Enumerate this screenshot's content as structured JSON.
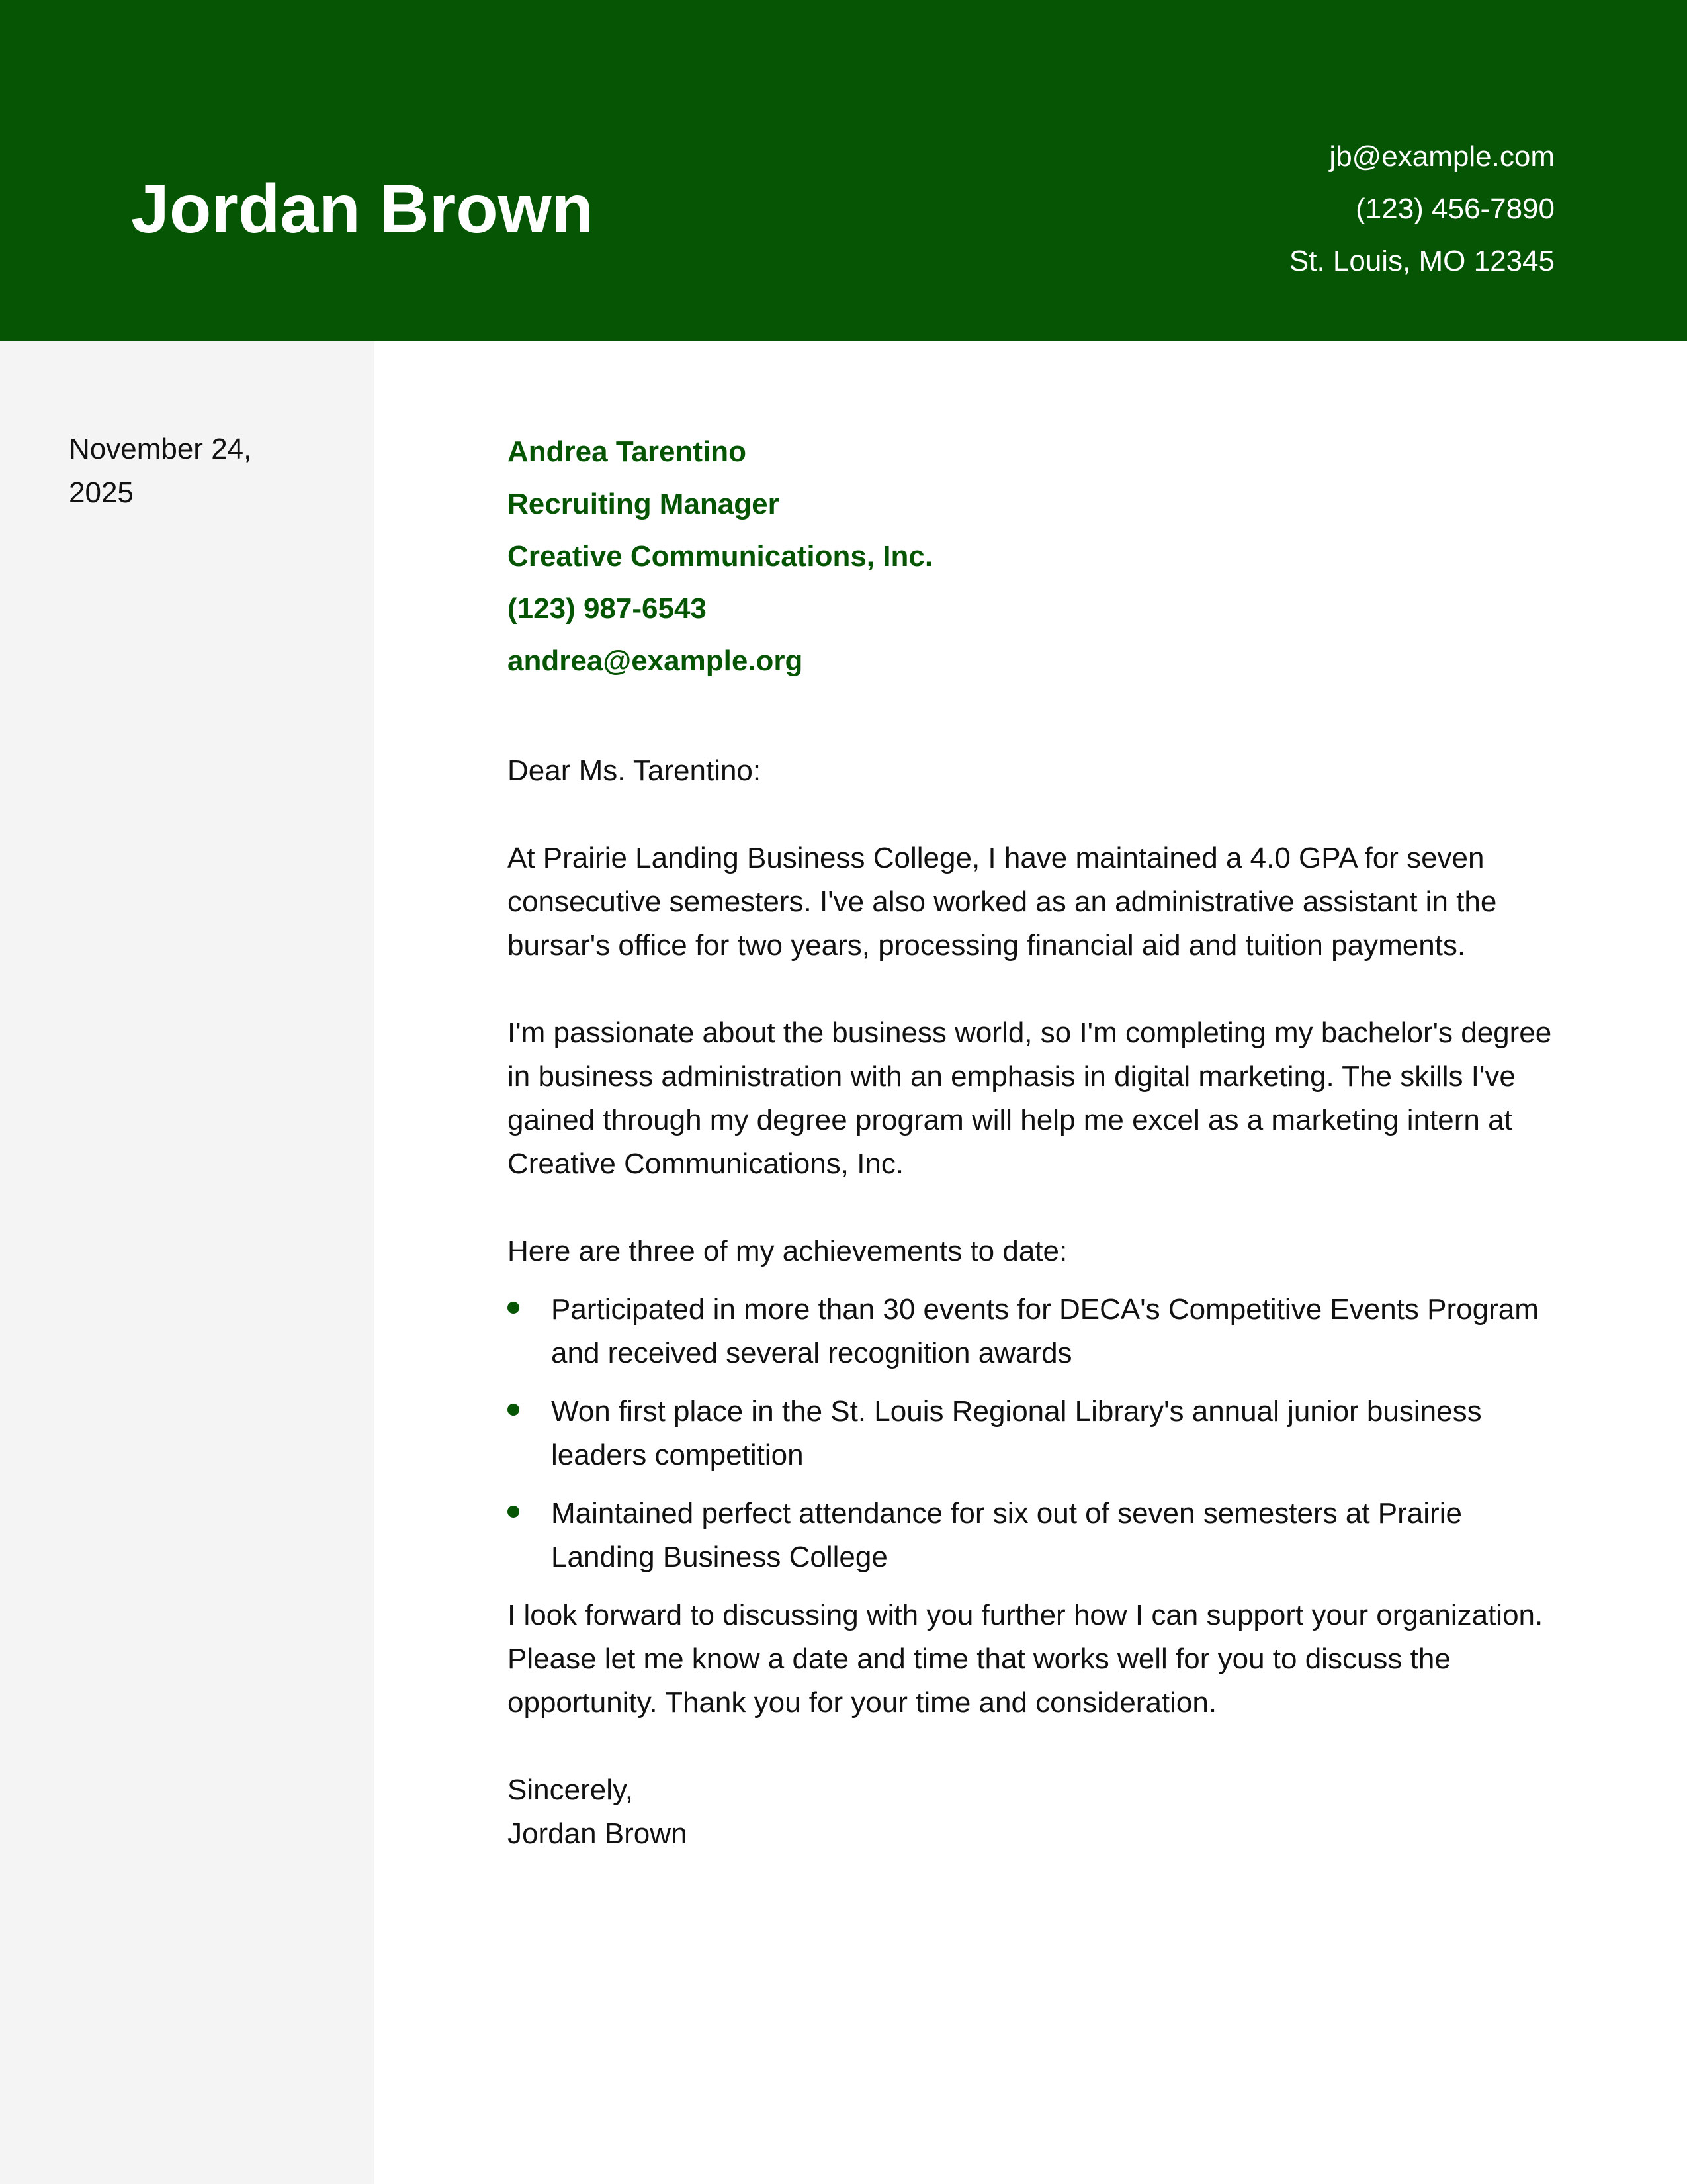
{
  "header": {
    "name": "Jordan Brown",
    "email": "jb@example.com",
    "phone": "(123) 456-7890",
    "location": "St. Louis, MO 12345"
  },
  "sidebar": {
    "date": "November 24, 2025"
  },
  "recipient": {
    "name": "Andrea Tarentino",
    "title": "Recruiting Manager",
    "company": "Creative Communications, Inc.",
    "phone": "(123) 987-6543",
    "email": "andrea@example.org"
  },
  "letter": {
    "salutation": "Dear Ms. Tarentino:",
    "paragraphs": [
      "At Prairie Landing Business College, I have maintained a 4.0 GPA for seven consecutive semesters. I've also worked as an administrative assistant in the bursar's office for two years, processing financial aid and tuition payments.",
      "I'm passionate about the business world, so I'm completing my bachelor's degree in business administration with an emphasis in digital marketing. The skills I've gained through my degree program will help me excel as a marketing intern at Creative Communications, Inc.",
      "Here are three of my achievements to date:"
    ],
    "achievements": [
      "Participated in more than 30 events for DECA's Competitive Events Program and received several recognition awards",
      "Won first place in the St. Louis Regional Library's annual junior business leaders competition",
      "Maintained perfect attendance for six out of seven semesters at Prairie Landing Business College"
    ],
    "closing_paragraph": "I look forward to discussing with you further how I can support your organization. Please let me know a date and time that works well for you to discuss the opportunity. Thank you for your time and consideration.",
    "signoff": "Sincerely,",
    "signature": "Jordan Brown"
  },
  "colors": {
    "accent": "#065505",
    "sidebar_bg": "#f4f4f4",
    "text": "#111111"
  }
}
